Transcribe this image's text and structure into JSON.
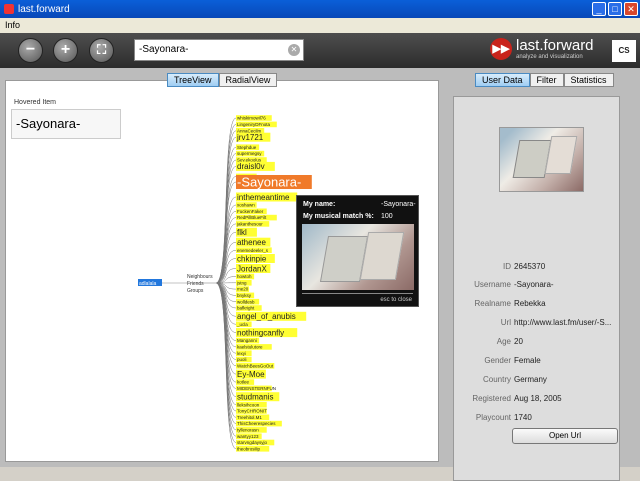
{
  "window": {
    "title": "last.forward",
    "min": "_",
    "max": "□",
    "close": "✕"
  },
  "menu": {
    "items": [
      "Info"
    ]
  },
  "toolbar": {
    "zoom_out": "−",
    "zoom_in": "+",
    "fit": "⛶",
    "search_value": "-Sayonara-",
    "clear": "✕",
    "logo_mark": "▶▶",
    "logo_text": "last.forward",
    "logo_sub": "analyze and visualization",
    "partner_logo": "CS"
  },
  "view_tabs": [
    "TreeView",
    "RadialView"
  ],
  "hovered": {
    "label": "Hovered Item",
    "value": "-Sayonara-"
  },
  "graph": {
    "center_node": "adlalala",
    "branch_labels": [
      "Neighbours",
      "Friends",
      "Groups"
    ],
    "neighbours_top": [
      "whiskimowil76",
      "LingeniryDFnota",
      "AnnaCecilm",
      "jrv1721",
      "Stephdue",
      "supermegsy",
      "Sev.ekoolus",
      "draisl0v",
      "reynsum"
    ],
    "highlight_node": "-Sayonara-",
    "second_node": "inthemeantime",
    "neighbours_bottom": [
      "xoshawn",
      "FuckenFaker",
      "RedPillBlueFilt",
      "jakanthesour",
      "flkl",
      "athenee",
      "enemedeeler_s",
      "chkinpie",
      "JordanX",
      "howtoh",
      "jstng",
      "me20",
      "bnyksy",
      "wolldesb",
      "bafkright",
      "angel_of_anubis",
      "_ucla",
      "nothingcanfly",
      "Manganni",
      "kaelstulutore",
      "lexyi",
      "puoli",
      "WatchBeesGoOut",
      "Ey-Moe",
      "kotlee",
      "MIDENSTERNFUN",
      "studmanis",
      "lleksihcoon",
      "TonyCHRONIT",
      "Treehitol.M1",
      "ThisCheerespecies",
      "tyllenorasn",
      "wantyy123",
      "starvngdaysyjo",
      "theobrosilip"
    ],
    "big_nodes": [
      "jrv1721",
      "draisl0v",
      "flkl",
      "athenee",
      "chkinpie",
      "JordanX",
      "angel_of_anubis",
      "nothingcanfly",
      "Ey-Moe",
      "studmanis"
    ]
  },
  "tooltip": {
    "name_label": "My name:",
    "name_value": "-Sayonara-",
    "match_label": "My musical match %:",
    "match_value": "100",
    "close_hint": "esc to close"
  },
  "side_tabs": [
    "User Data",
    "Filter",
    "Statistics"
  ],
  "user": {
    "fields": [
      {
        "label": "ID",
        "value": "2645370"
      },
      {
        "label": "Username",
        "value": "-Sayonara-"
      },
      {
        "label": "Realname",
        "value": "Rebekka"
      },
      {
        "label": "Url",
        "value": "http://www.last.fm/user/-S..."
      },
      {
        "label": "Age",
        "value": "20"
      },
      {
        "label": "Gender",
        "value": "Female"
      },
      {
        "label": "Country",
        "value": "Germany"
      },
      {
        "label": "Registered",
        "value": "Aug 18, 2005"
      },
      {
        "label": "Playcount",
        "value": "1740"
      }
    ],
    "open_url_label": "Open Url"
  },
  "colors": {
    "node_yellow": "#ffff33",
    "highlight_orange": "#f07a2a",
    "center_blue": "#2277dd",
    "tab_active": "#9fcdf3"
  }
}
